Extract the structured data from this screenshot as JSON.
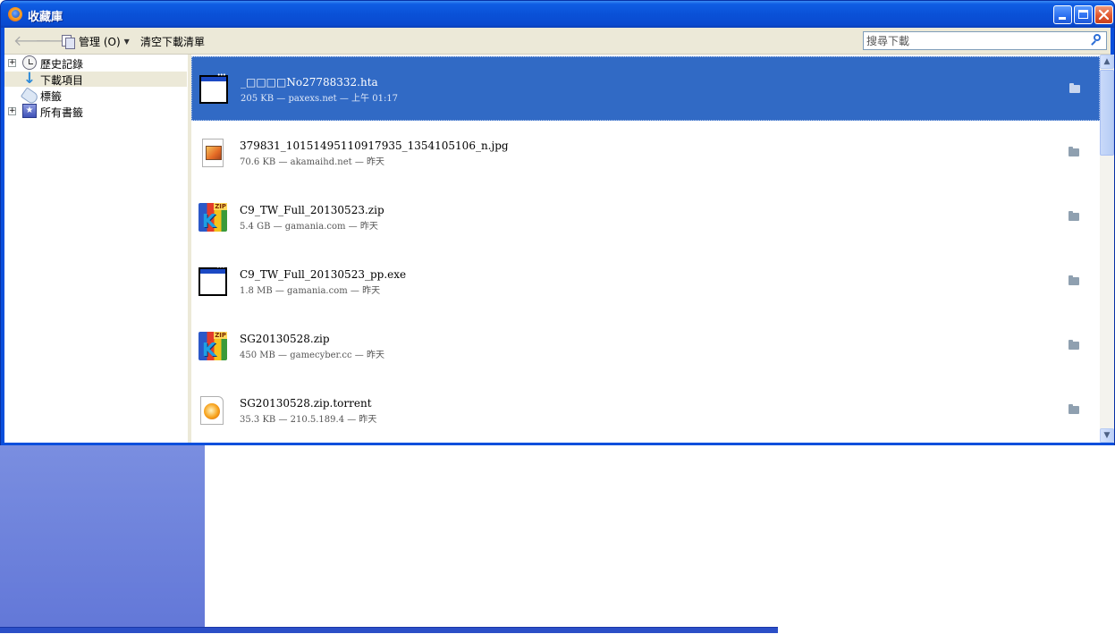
{
  "window": {
    "title": "收藏庫"
  },
  "toolbar": {
    "organize_label": "管理 (O)",
    "clear_downloads_label": "清空下載清單",
    "search": {
      "placeholder": "搜尋下載",
      "value": ""
    }
  },
  "sidebar": {
    "items": [
      {
        "label": "歷史記錄",
        "icon": "history-icon",
        "expandable": true
      },
      {
        "label": "下載項目",
        "icon": "download-icon",
        "expandable": false,
        "selected": true
      },
      {
        "label": "標籤",
        "icon": "tag-icon",
        "expandable": false
      },
      {
        "label": "所有書籤",
        "icon": "bookmarks-icon",
        "expandable": true
      }
    ]
  },
  "downloads": [
    {
      "name": "_□□□□No27788332.hta",
      "status": "205 KB — paxexs.net — 上午 01:17",
      "icon": "executable-file-icon",
      "selected": true
    },
    {
      "name": "379831_10151495110917935_1354105106_n.jpg",
      "status": "70.6 KB — akamaihd.net — 昨天",
      "icon": "image-file-icon",
      "selected": false
    },
    {
      "name": "C9_TW_Full_20130523.zip",
      "status": "5.4 GB — gamania.com — 昨天",
      "icon": "zip-archive-icon",
      "selected": false
    },
    {
      "name": "C9_TW_Full_20130523_pp.exe",
      "status": "1.8 MB — gamania.com — 昨天",
      "icon": "executable-file-icon",
      "selected": false
    },
    {
      "name": "SG20130528.zip",
      "status": "450 MB — gamecyber.cc — 昨天",
      "icon": "zip-archive-icon",
      "selected": false
    },
    {
      "name": "SG20130528.zip.torrent",
      "status": "35.3 KB — 210.5.189.4 — 昨天",
      "icon": "torrent-file-icon",
      "selected": false
    }
  ],
  "colors": {
    "selection": "#316ac5",
    "titlebar": "#0a4fdc"
  }
}
